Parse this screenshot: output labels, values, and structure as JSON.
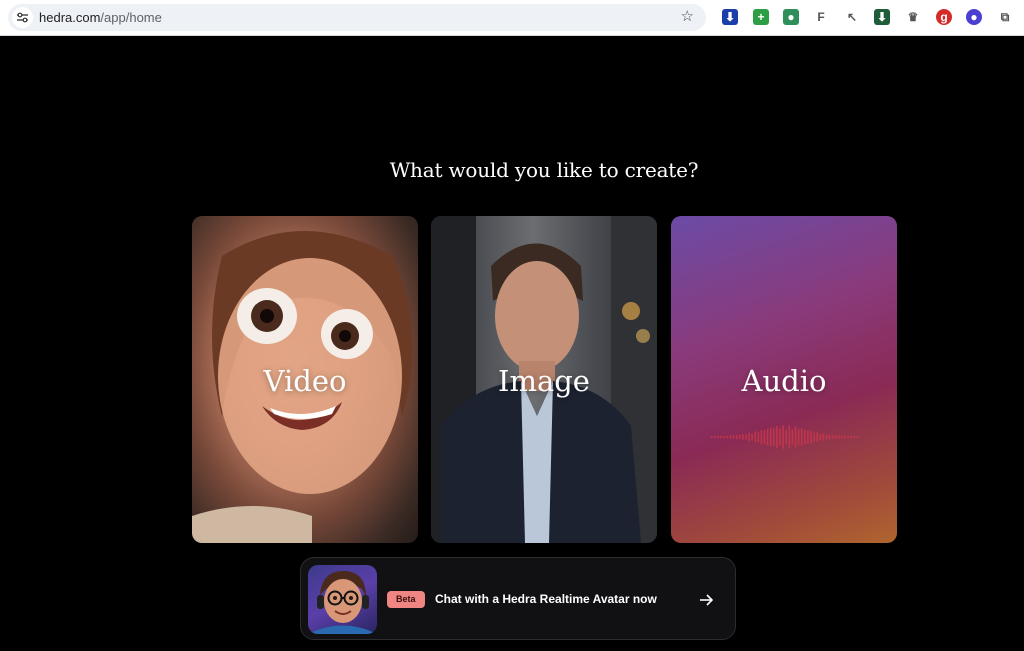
{
  "browser": {
    "url_domain": "hedra.com",
    "url_path": "/app/home",
    "extensions": [
      {
        "name": "download-extension-icon",
        "color": "#1a3fa8",
        "glyph": "⬇"
      },
      {
        "name": "add-extension-icon",
        "color": "#2e9e44",
        "glyph": "+"
      },
      {
        "name": "record-extension-icon",
        "color": "#2e8f5a",
        "glyph": "●"
      },
      {
        "name": "font-extension-icon",
        "color": "#ffffff",
        "glyph": "F"
      },
      {
        "name": "picker-extension-icon",
        "color": "#ffffff",
        "glyph": "↖"
      },
      {
        "name": "arrow-down-extension-icon",
        "color": "#1f5c3a",
        "glyph": "⬇"
      },
      {
        "name": "crown-extension-icon",
        "color": "#ffffff",
        "glyph": "♛"
      },
      {
        "name": "g-extension-icon",
        "color": "#d42a2a",
        "glyph": "g"
      },
      {
        "name": "bot-extension-icon",
        "color": "#4a3fd0",
        "glyph": "●"
      },
      {
        "name": "puzzle-extension-icon",
        "color": "#ffffff",
        "glyph": "⧉"
      }
    ]
  },
  "main": {
    "heading": "What would you like to create?",
    "cards": [
      {
        "label": "Video"
      },
      {
        "label": "Image"
      },
      {
        "label": "Audio"
      }
    ]
  },
  "banner": {
    "badge": "Beta",
    "text": "Chat with a Hedra Realtime Avatar now"
  },
  "colors": {
    "beta_badge": "#f08684",
    "page_background": "#000000"
  }
}
